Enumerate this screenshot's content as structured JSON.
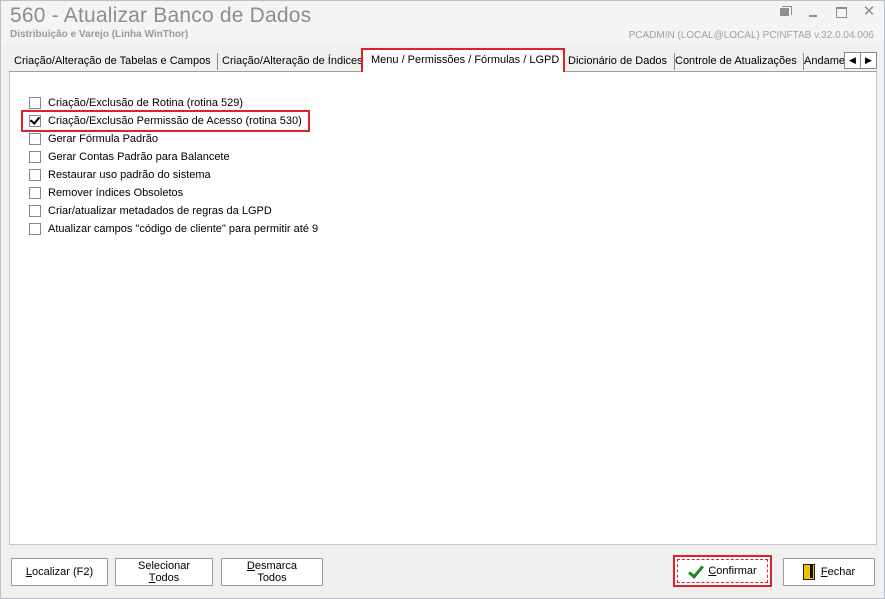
{
  "window": {
    "title": "560 - Atualizar Banco de Dados",
    "subtitle": "Distribuição e Varejo (Linha WinThor)",
    "session": "PCADMIN (LOCAL@LOCAL)   PCINFTAB  v.32.0.04.006"
  },
  "tabs": [
    {
      "label": "Criação/Alteração de Tabelas e Campos"
    },
    {
      "label": "Criação/Alteração de Índices"
    },
    {
      "label": "Menu / Permissões / Fórmulas / LGPD"
    },
    {
      "label": "Dicionário de Dados"
    },
    {
      "label": "Controle de Atualizações"
    },
    {
      "label": "Andamento"
    }
  ],
  "options": [
    {
      "label": "Criação/Exclusão de Rotina (rotina 529)",
      "checked": false
    },
    {
      "label": "Criação/Exclusão Permissão de Acesso (rotina 530)",
      "checked": true
    },
    {
      "label": "Gerar Fórmula Padrão",
      "checked": false
    },
    {
      "label": "Gerar Contas Padrão para Balancete",
      "checked": false
    },
    {
      "label": "Restaurar uso padrão do sistema",
      "checked": false
    },
    {
      "label": "Remover índices Obsoletos",
      "checked": false
    },
    {
      "label": "Criar/atualizar metadados de regras da LGPD",
      "checked": false
    },
    {
      "label": "Atualizar campos \"código de cliente\" para permitir até 9",
      "checked": false
    }
  ],
  "buttons": {
    "localizar": {
      "pre": "",
      "u": "L",
      "post": "ocalizar (F2)"
    },
    "selecionar": {
      "pre": "Selecionar ",
      "u": "T",
      "post": "odos"
    },
    "desmarca": {
      "pre": "",
      "u": "D",
      "post": "esmarca Todos"
    },
    "confirmar": {
      "pre": "",
      "u": "C",
      "post": "onfirmar"
    },
    "fechar": {
      "pre": "",
      "u": "F",
      "post": "echar"
    }
  },
  "icons": {
    "confirm": "check-icon",
    "close": "door-exit-icon"
  },
  "colors": {
    "highlight": "#e0202a",
    "check": "#1f8a1f"
  }
}
